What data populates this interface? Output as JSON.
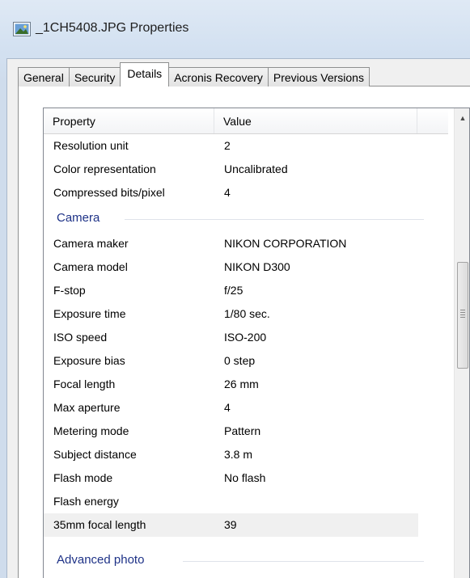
{
  "window": {
    "title": "_1CH5408.JPG Properties"
  },
  "tabs": [
    {
      "label": "General",
      "active": false
    },
    {
      "label": "Security",
      "active": false
    },
    {
      "label": "Details",
      "active": true
    },
    {
      "label": "Acronis Recovery",
      "active": false
    },
    {
      "label": "Previous Versions",
      "active": false
    }
  ],
  "list": {
    "columns": {
      "property": "Property",
      "value": "Value"
    },
    "rows_top": [
      {
        "property": "Resolution unit",
        "value": "2"
      },
      {
        "property": "Color representation",
        "value": "Uncalibrated"
      },
      {
        "property": "Compressed bits/pixel",
        "value": "4"
      }
    ],
    "group_camera": "Camera",
    "rows_camera": [
      {
        "property": "Camera maker",
        "value": "NIKON CORPORATION"
      },
      {
        "property": "Camera model",
        "value": "NIKON D300"
      },
      {
        "property": "F-stop",
        "value": "f/25"
      },
      {
        "property": "Exposure time",
        "value": "1/80 sec."
      },
      {
        "property": "ISO speed",
        "value": "ISO-200"
      },
      {
        "property": "Exposure bias",
        "value": "0 step"
      },
      {
        "property": "Focal length",
        "value": "26 mm"
      },
      {
        "property": "Max aperture",
        "value": "4"
      },
      {
        "property": "Metering mode",
        "value": "Pattern"
      },
      {
        "property": "Subject distance",
        "value": "3.8 m"
      },
      {
        "property": "Flash mode",
        "value": "No flash"
      },
      {
        "property": "Flash energy",
        "value": ""
      },
      {
        "property": "35mm focal length",
        "value": "39",
        "selected": true
      }
    ],
    "group_advanced": "Advanced photo"
  },
  "colors": {
    "group_heading": "#1e3287",
    "selected_row": "#f0f0f0",
    "window_frame": "#d3e1f1"
  },
  "icons": {
    "title": "image-file-icon",
    "scroll_up": "scroll-up-arrow-icon",
    "scroll_down": "scroll-down-arrow-icon"
  }
}
